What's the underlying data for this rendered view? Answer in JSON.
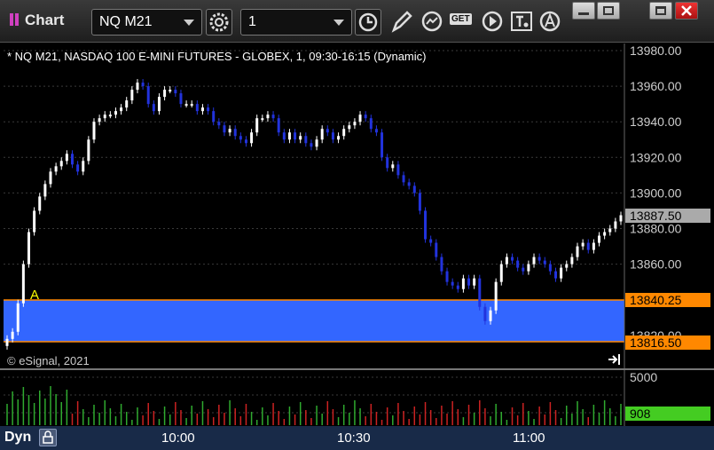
{
  "toolbar": {
    "app_title": "Chart",
    "symbol": "NQ M21",
    "interval": "1",
    "get_label": "GET",
    "colors": {
      "background": "#2a2a2a"
    },
    "icons": [
      "settings-icon",
      "clock-icon",
      "pencil-icon",
      "study-icon",
      "get-icon",
      "play-icon",
      "text-tool-icon",
      "alert-icon"
    ],
    "window_controls": [
      "minimize-icon",
      "restore-icon",
      "maximize-icon",
      "close-icon"
    ]
  },
  "chart": {
    "header": "* NQ M21, NASDAQ 100 E-MINI FUTURES - GLOBEX, 1, 09:30-16:15 (Dynamic)",
    "copyright": "© eSignal, 2021",
    "marker_label": "A",
    "price_axis_labels": [
      "13980.00",
      "13960.00",
      "13940.00",
      "13920.00",
      "13900.00",
      "13880.00",
      "13860.00",
      "13820.00"
    ],
    "last_price_label": "13887.50",
    "zone_top_label": "13840.25",
    "zone_bottom_label": "13816.50",
    "volume_axis_label": "5000",
    "volume_last_label": "908",
    "time_labels": [
      "10:00",
      "10:30",
      "11:00"
    ],
    "mode_label": "Dyn",
    "colors": {
      "up": "#ffffff",
      "down": "#2233dd",
      "zone_fill": "#3366ff",
      "zone_border": "#ff8800",
      "vol_up": "#2faa2f",
      "vol_down": "#cc2222",
      "last_price_bg": "#aaaaaa",
      "volume_last_bg": "#44cc22",
      "marker": "#ffff00",
      "grid": "#3a3a3a"
    }
  },
  "chart_data": {
    "type": "candlestick",
    "title": "* NQ M21, NASDAQ 100 E-MINI FUTURES - GLOBEX, 1, 09:30-16:15 (Dynamic)",
    "xlabel": "",
    "ylabel": "",
    "x_ticks": [
      "10:00",
      "10:30",
      "11:00"
    ],
    "ylim": [
      13805,
      13985
    ],
    "grid": true,
    "shaded_zone": [
      13816.5,
      13840.25
    ],
    "last_price": 13887.5,
    "volume_ylim": [
      0,
      5000
    ],
    "last_volume": 908,
    "close_trajectory": [
      13818,
      13822,
      13838,
      13860,
      13878,
      13890,
      13898,
      13905,
      13912,
      13915,
      13918,
      13922,
      13916,
      13912,
      13918,
      13930,
      13940,
      13942,
      13944,
      13944,
      13946,
      13948,
      13952,
      13958,
      13962,
      13960,
      13950,
      13946,
      13954,
      13958,
      13958,
      13956,
      13950,
      13950,
      13950,
      13946,
      13948,
      13946,
      13940,
      13938,
      13934,
      13936,
      13932,
      13930,
      13928,
      13934,
      13942,
      13942,
      13944,
      13942,
      13934,
      13930,
      13934,
      13930,
      13932,
      13928,
      13926,
      13930,
      13936,
      13934,
      13930,
      13932,
      13936,
      13938,
      13940,
      13944,
      13942,
      13936,
      13934,
      13920,
      13914,
      13916,
      13910,
      13906,
      13904,
      13900,
      13890,
      13874,
      13872,
      13864,
      13856,
      13850,
      13848,
      13846,
      13852,
      13848,
      13852,
      13836,
      13828,
      13834,
      13850,
      13860,
      13864,
      13862,
      13858,
      13856,
      13860,
      13864,
      13862,
      13860,
      13856,
      13852,
      13858,
      13860,
      13864,
      13870,
      13872,
      13868,
      13872,
      13876,
      13878,
      13880,
      13884,
      13887.5
    ]
  }
}
